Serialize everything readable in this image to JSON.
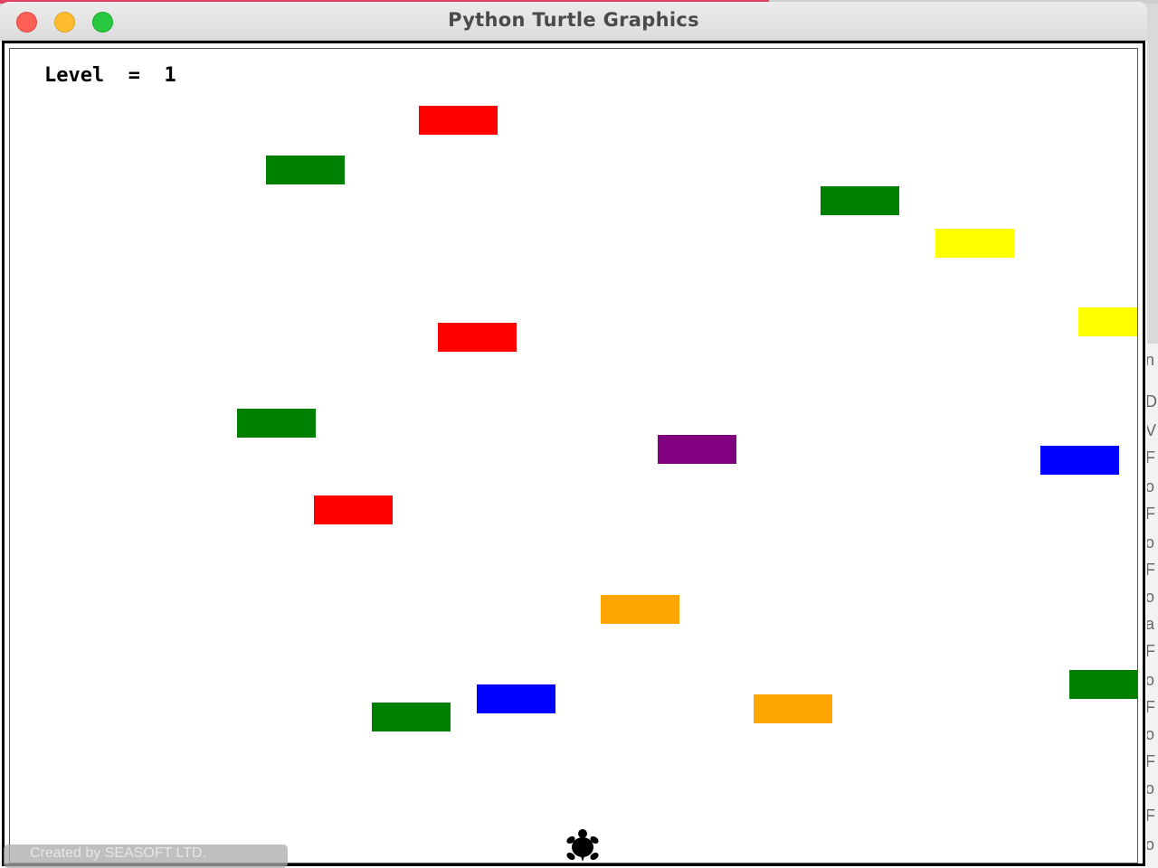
{
  "window": {
    "title": "Python Turtle Graphics",
    "controls": {
      "close_color": "#fe5f57",
      "minimize_color": "#febc2e",
      "maximize_color": "#28c840"
    }
  },
  "game": {
    "level_text": "Level  =  1",
    "player": {
      "shape": "turtle",
      "color": "#000000"
    },
    "blocks": [
      {
        "color": "red"
      },
      {
        "color": "green"
      },
      {
        "color": "green"
      },
      {
        "color": "yellow"
      },
      {
        "color": "yellow"
      },
      {
        "color": "red"
      },
      {
        "color": "green"
      },
      {
        "color": "purple"
      },
      {
        "color": "blue"
      },
      {
        "color": "red"
      },
      {
        "color": "orange"
      },
      {
        "color": "green"
      },
      {
        "color": "blue"
      },
      {
        "color": "green"
      },
      {
        "color": "orange"
      }
    ]
  },
  "overlay": {
    "watermark": "Created by SEASOFT LTD."
  },
  "background_window": {
    "visible_fragments": [
      "n",
      "D",
      "V",
      "F",
      "o",
      "F",
      "o",
      "F",
      "o",
      "a",
      "F",
      "o",
      "F",
      "o",
      "F",
      "o",
      "F",
      "o"
    ]
  },
  "colors": {
    "red": "#ff0000",
    "green": "#008000",
    "yellow": "#ffff00",
    "blue": "#0000ff",
    "purple": "#800080",
    "orange": "#ffa500"
  }
}
